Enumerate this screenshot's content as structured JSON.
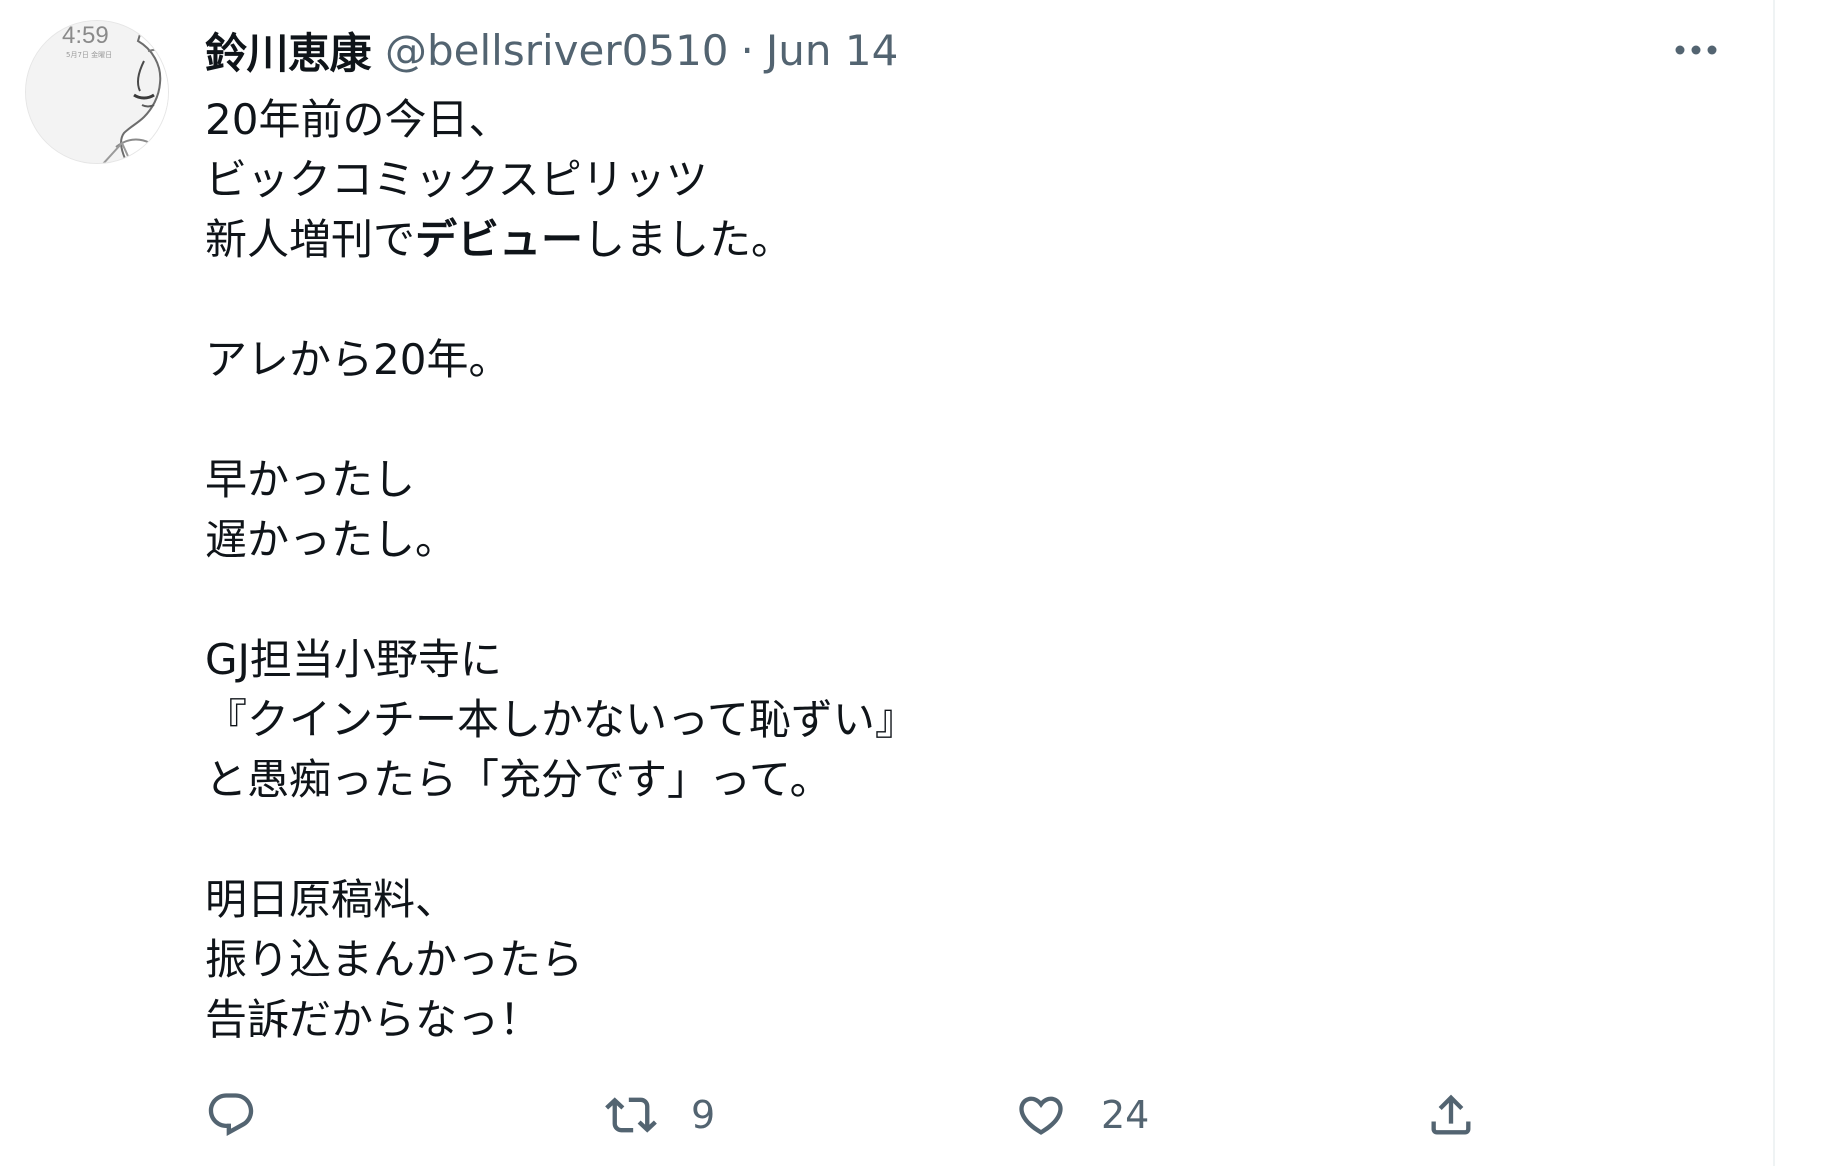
{
  "tweet": {
    "author": {
      "display_name": "鈴川恵康",
      "handle": "@bellsriver0510",
      "avatar_clock_text": "4:59",
      "avatar_date_text": "5月7日 金曜日"
    },
    "separator": "·",
    "date": "Jun 14",
    "text_lines": [
      "20年前の今日、",
      "ビックコミックスピリッツ",
      {
        "before": "新人増刊で",
        "bold": "デビュー",
        "after": "しました。"
      },
      "",
      "アレから20年。",
      "",
      "早かったし",
      "遅かったし。",
      "",
      "GJ担当小野寺に",
      "『クインチー本しかないって恥ずい』",
      "と愚痴ったら「充分です」って。",
      "",
      "明日原稿料、",
      "振り込まんかったら",
      "告訴だからなっ！"
    ],
    "actions": {
      "reply_icon": "reply-icon",
      "retweet_icon": "retweet-icon",
      "retweet_count": "9",
      "like_icon": "heart-icon",
      "like_count": "24",
      "share_icon": "share-icon"
    },
    "more_icon": "more-dots-icon"
  },
  "colors": {
    "primary_text": "#0f1419",
    "secondary_text": "#536471",
    "divider": "#eff3f4"
  }
}
